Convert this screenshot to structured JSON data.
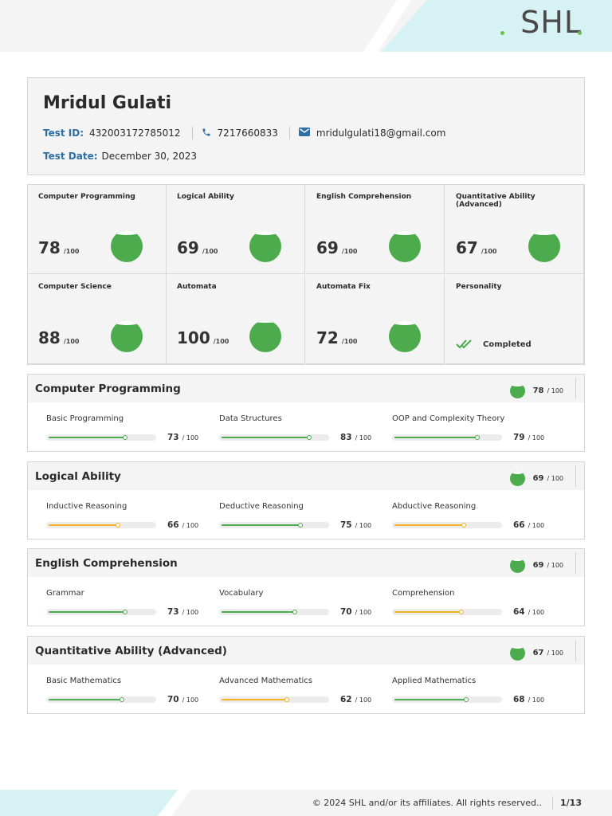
{
  "brand": {
    "logo_text": "SHL",
    "accent": "#6cc04a"
  },
  "candidate": {
    "name": "Mridul Gulati",
    "test_id_label": "Test ID:",
    "test_id": "432003172785012",
    "phone": "7217660833",
    "email": "mridulgulati18@gmail.com",
    "test_date_label": "Test Date:",
    "test_date": "December 30, 2023"
  },
  "summary_tiles": [
    {
      "title": "Computer Programming",
      "score": "78",
      "of": "/100"
    },
    {
      "title": "Logical Ability",
      "score": "69",
      "of": "/100"
    },
    {
      "title": "English Comprehension",
      "score": "69",
      "of": "/100"
    },
    {
      "title": "Quantitative Ability (Advanced)",
      "score": "67",
      "of": "/100"
    },
    {
      "title": "Computer Science",
      "score": "88",
      "of": "/100"
    },
    {
      "title": "Automata",
      "score": "100",
      "of": "/100"
    },
    {
      "title": "Automata Fix",
      "score": "72",
      "of": "/100"
    },
    {
      "title": "Personality",
      "status": "Completed"
    }
  ],
  "sections": [
    {
      "title": "Computer Programming",
      "score": "78",
      "of": "/ 100",
      "subs": [
        {
          "label": "Basic Programming",
          "score": "73",
          "of": "/ 100",
          "value": 73,
          "color": "#4bab4d"
        },
        {
          "label": "Data Structures",
          "score": "83",
          "of": "/ 100",
          "value": 83,
          "color": "#4bab4d"
        },
        {
          "label": "OOP and Complexity Theory",
          "score": "79",
          "of": "/ 100",
          "value": 79,
          "color": "#4bab4d"
        }
      ]
    },
    {
      "title": "Logical Ability",
      "score": "69",
      "of": "/ 100",
      "subs": [
        {
          "label": "Inductive Reasoning",
          "score": "66",
          "of": "/ 100",
          "value": 66,
          "color": "#f5b120"
        },
        {
          "label": "Deductive Reasoning",
          "score": "75",
          "of": "/ 100",
          "value": 75,
          "color": "#4bab4d"
        },
        {
          "label": "Abductive Reasoning",
          "score": "66",
          "of": "/ 100",
          "value": 66,
          "color": "#f5b120"
        }
      ]
    },
    {
      "title": "English Comprehension",
      "score": "69",
      "of": "/ 100",
      "subs": [
        {
          "label": "Grammar",
          "score": "73",
          "of": "/ 100",
          "value": 73,
          "color": "#4bab4d"
        },
        {
          "label": "Vocabulary",
          "score": "70",
          "of": "/ 100",
          "value": 70,
          "color": "#4bab4d"
        },
        {
          "label": "Comprehension",
          "score": "64",
          "of": "/ 100",
          "value": 64,
          "color": "#f5b120"
        }
      ]
    },
    {
      "title": "Quantitative Ability (Advanced)",
      "score": "67",
      "of": "/ 100",
      "subs": [
        {
          "label": "Basic Mathematics",
          "score": "70",
          "of": "/ 100",
          "value": 70,
          "color": "#4bab4d"
        },
        {
          "label": "Advanced Mathematics",
          "score": "62",
          "of": "/ 100",
          "value": 62,
          "color": "#f5b120"
        },
        {
          "label": "Applied Mathematics",
          "score": "68",
          "of": "/ 100",
          "value": 68,
          "color": "#4bab4d"
        }
      ]
    }
  ],
  "footer": {
    "copyright": "© 2024 SHL and/or its affiliates. All rights reserved..",
    "page": "1/13"
  }
}
